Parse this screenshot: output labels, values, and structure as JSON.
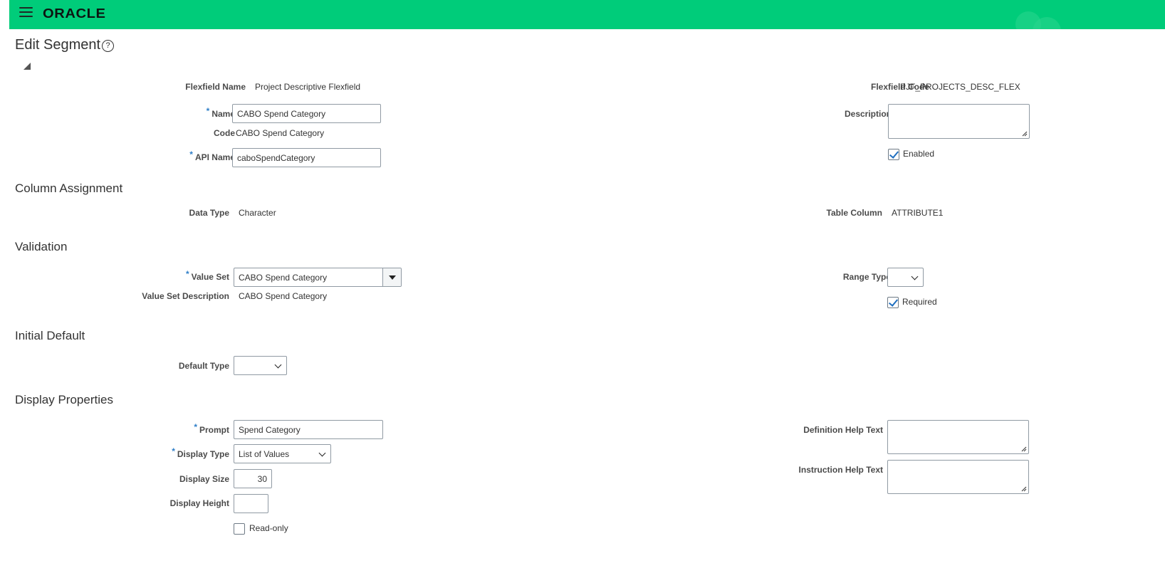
{
  "header": {
    "brand": "ORACLE"
  },
  "page": {
    "title": "Edit Segment",
    "help_glyph": "?"
  },
  "segment": {
    "flexfield_name_label": "Flexfield Name",
    "flexfield_name": "Project Descriptive Flexfield",
    "flexfield_code_label": "Flexfield Code",
    "flexfield_code": "PJF_PROJECTS_DESC_FLEX",
    "name_label": "Name",
    "name": "CABO Spend Category",
    "code_label": "Code",
    "code": "CABO Spend Category",
    "api_name_label": "API Name",
    "api_name": "caboSpendCategory",
    "description_label": "Description",
    "enabled_label": "Enabled",
    "enabled": true
  },
  "column_assignment": {
    "title": "Column Assignment",
    "data_type_label": "Data Type",
    "data_type": "Character",
    "table_column_label": "Table Column",
    "table_column": "ATTRIBUTE1"
  },
  "validation": {
    "title": "Validation",
    "value_set_label": "Value Set",
    "value_set": "CABO Spend Category",
    "value_set_description_label": "Value Set Description",
    "value_set_description": "CABO Spend Category",
    "range_type_label": "Range Type",
    "range_type": "",
    "required_label": "Required",
    "required": true
  },
  "initial_default": {
    "title": "Initial Default",
    "default_type_label": "Default Type",
    "default_type": ""
  },
  "display_properties": {
    "title": "Display Properties",
    "prompt_label": "Prompt",
    "prompt": "Spend Category",
    "display_type_label": "Display Type",
    "display_type": "List of Values",
    "display_size_label": "Display Size",
    "display_size": "30",
    "display_height_label": "Display Height",
    "display_height": "",
    "read_only_label": "Read-only",
    "read_only": false,
    "definition_help_label": "Definition Help Text",
    "instruction_help_label": "Instruction Help Text"
  },
  "required_marker": "*"
}
